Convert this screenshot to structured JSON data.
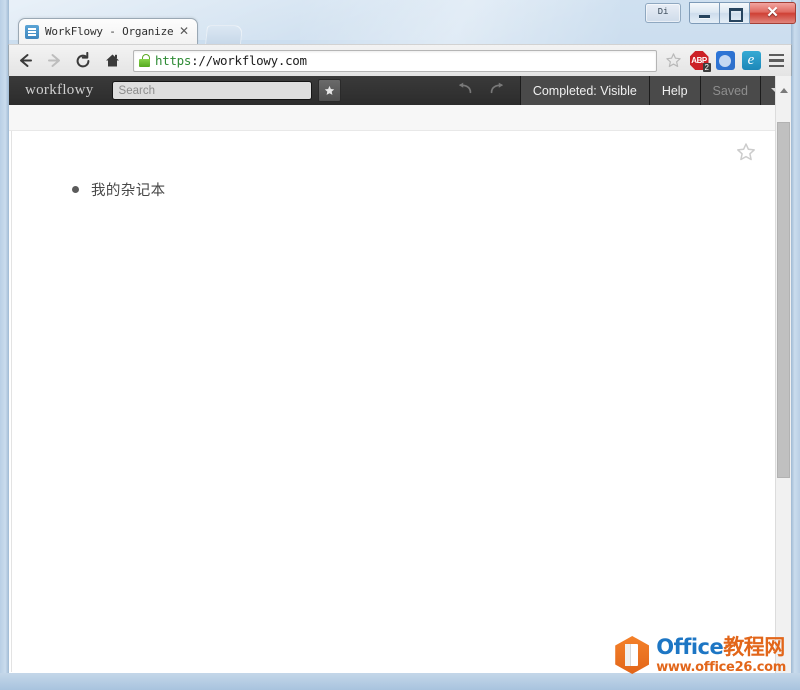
{
  "window": {
    "extra_button_label": "Di",
    "minimize_label": "Minimize",
    "maximize_label": "Maximize",
    "close_label": "✕"
  },
  "browser": {
    "tab": {
      "title": "WorkFlowy - Organize yo",
      "close_label": "✕",
      "favicon": "workflowy-favicon"
    },
    "new_tab_label": "",
    "nav": {
      "back": "back-arrow",
      "forward": "forward-arrow",
      "reload": "reload-arrow",
      "home": "home-icon"
    },
    "omnibox": {
      "scheme": "https",
      "rest": "://workflowy.com",
      "full_url": "https://workflowy.com",
      "security": "secure-lock",
      "bookmark_star": "star-outline-icon"
    },
    "extensions": [
      {
        "name": "adblock-plus",
        "label": "ABP",
        "badge": "2"
      },
      {
        "name": "blue-circle-extension",
        "label": ""
      },
      {
        "name": "e-extension",
        "label": "e"
      }
    ],
    "menu_label": "hamburger-menu"
  },
  "app": {
    "logo": "workflowy",
    "search": {
      "value": "",
      "placeholder": "Search"
    },
    "star_button": "★",
    "undo_label": "undo",
    "redo_label": "redo",
    "buttons": [
      {
        "name": "completed-visibility",
        "label": "Completed: Visible",
        "dim": false
      },
      {
        "name": "help",
        "label": "Help",
        "dim": false
      },
      {
        "name": "save-status",
        "label": "Saved",
        "dim": true
      }
    ],
    "dropdown_label": "account-menu-caret"
  },
  "page": {
    "star_icon": "star-outline-icon",
    "outline": [
      {
        "text": "我的杂记本"
      }
    ]
  },
  "scrollbar": {
    "up_arrow": "scroll-up-arrow",
    "thumb_label": "vertical-scroll-thumb"
  },
  "watermark": {
    "brand_en": "Office",
    "brand_cn": "教程网",
    "url": "www.office26.com"
  },
  "colors": {
    "accent_green": "#2e8b35",
    "app_bar": "#2c2c2c",
    "watermark_blue": "#1d76c4",
    "watermark_orange": "#e2661a"
  }
}
